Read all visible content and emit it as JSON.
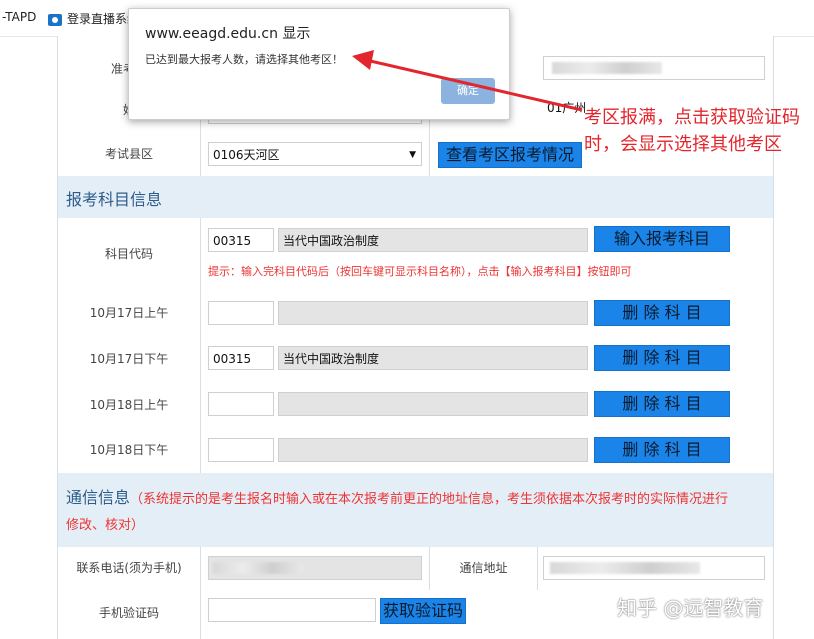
{
  "bookmarks": [
    {
      "label": "-TAPD"
    },
    {
      "label": "登录直播系统"
    }
  ],
  "rows": {
    "exam_no_label": "准考证",
    "name_label": "姓",
    "district_label": "考试县区",
    "district_value": "0106天河区",
    "city_value": "01广州",
    "view_district_button": "查看考区报考情况"
  },
  "subject_section": {
    "title": "报考科目信息",
    "code_label": "科目代码",
    "code_value": "00315",
    "code_name": "当代中国政治制度",
    "input_button": "输入报考科目",
    "hint": "提示：输入完科目代码后（按回车键可显示科目名称），点击【输入报考科目】按钮即可",
    "slots": [
      {
        "label": "10月17日上午",
        "code": "",
        "name": "",
        "button": "删 除 科 目"
      },
      {
        "label": "10月17日下午",
        "code": "00315",
        "name": "当代中国政治制度",
        "button": "删 除 科 目"
      },
      {
        "label": "10月18日上午",
        "code": "",
        "name": "",
        "button": "删 除 科 目"
      },
      {
        "label": "10月18日下午",
        "code": "",
        "name": "",
        "button": "删 除 科 目"
      }
    ]
  },
  "contact_section": {
    "title": "通信信息",
    "note": "（系统提示的是考生报名时输入或在本次报考前更正的地址信息，考生须依据本次报考时的实际情况进行",
    "note2": "修改、核对）",
    "phone_label": "联系电话(须为手机)",
    "address_label": "通信地址",
    "code_label": "手机验证码",
    "get_code_button": "获取验证码"
  },
  "dialog": {
    "title": "www.eeagd.edu.cn 显示",
    "message": "已达到最大报考人数，请选择其他考区！",
    "ok": "确定"
  },
  "annotation": "考区报满，点击获取验证码时，会显示选择其他考区",
  "watermark": "知乎 @远智教育",
  "colors": {
    "accent": "#1b84e8",
    "section_bg": "#e4eef7",
    "annotation": "#e3262d"
  }
}
